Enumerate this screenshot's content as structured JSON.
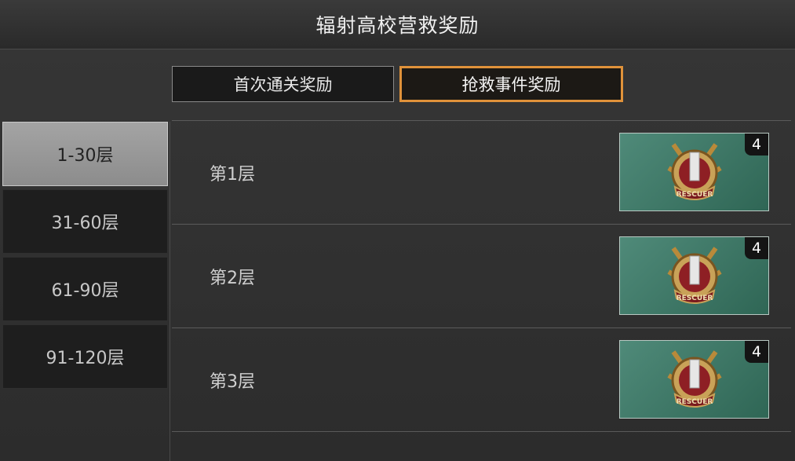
{
  "window": {
    "title": "辐射高校营救奖励"
  },
  "tabs": [
    {
      "label": "首次通关奖励",
      "selected": false
    },
    {
      "label": "抢救事件奖励",
      "selected": true
    }
  ],
  "floor_ranges": [
    {
      "label": "1-30层",
      "selected": true
    },
    {
      "label": "31-60层",
      "selected": false
    },
    {
      "label": "61-90层",
      "selected": false
    },
    {
      "label": "91-120层",
      "selected": false
    }
  ],
  "rows": [
    {
      "label": "第1层",
      "reward": {
        "icon": "rescuer-badge-icon",
        "medal_text": "RESCUER",
        "count": "4"
      }
    },
    {
      "label": "第2层",
      "reward": {
        "icon": "rescuer-badge-icon",
        "medal_text": "RESCUER",
        "count": "4"
      }
    },
    {
      "label": "第3层",
      "reward": {
        "icon": "rescuer-badge-icon",
        "medal_text": "RESCUER",
        "count": "4"
      }
    }
  ],
  "colors": {
    "accent": "#e0923a",
    "reward_bg": "#3f7a69",
    "selected_floor": "#999999"
  }
}
